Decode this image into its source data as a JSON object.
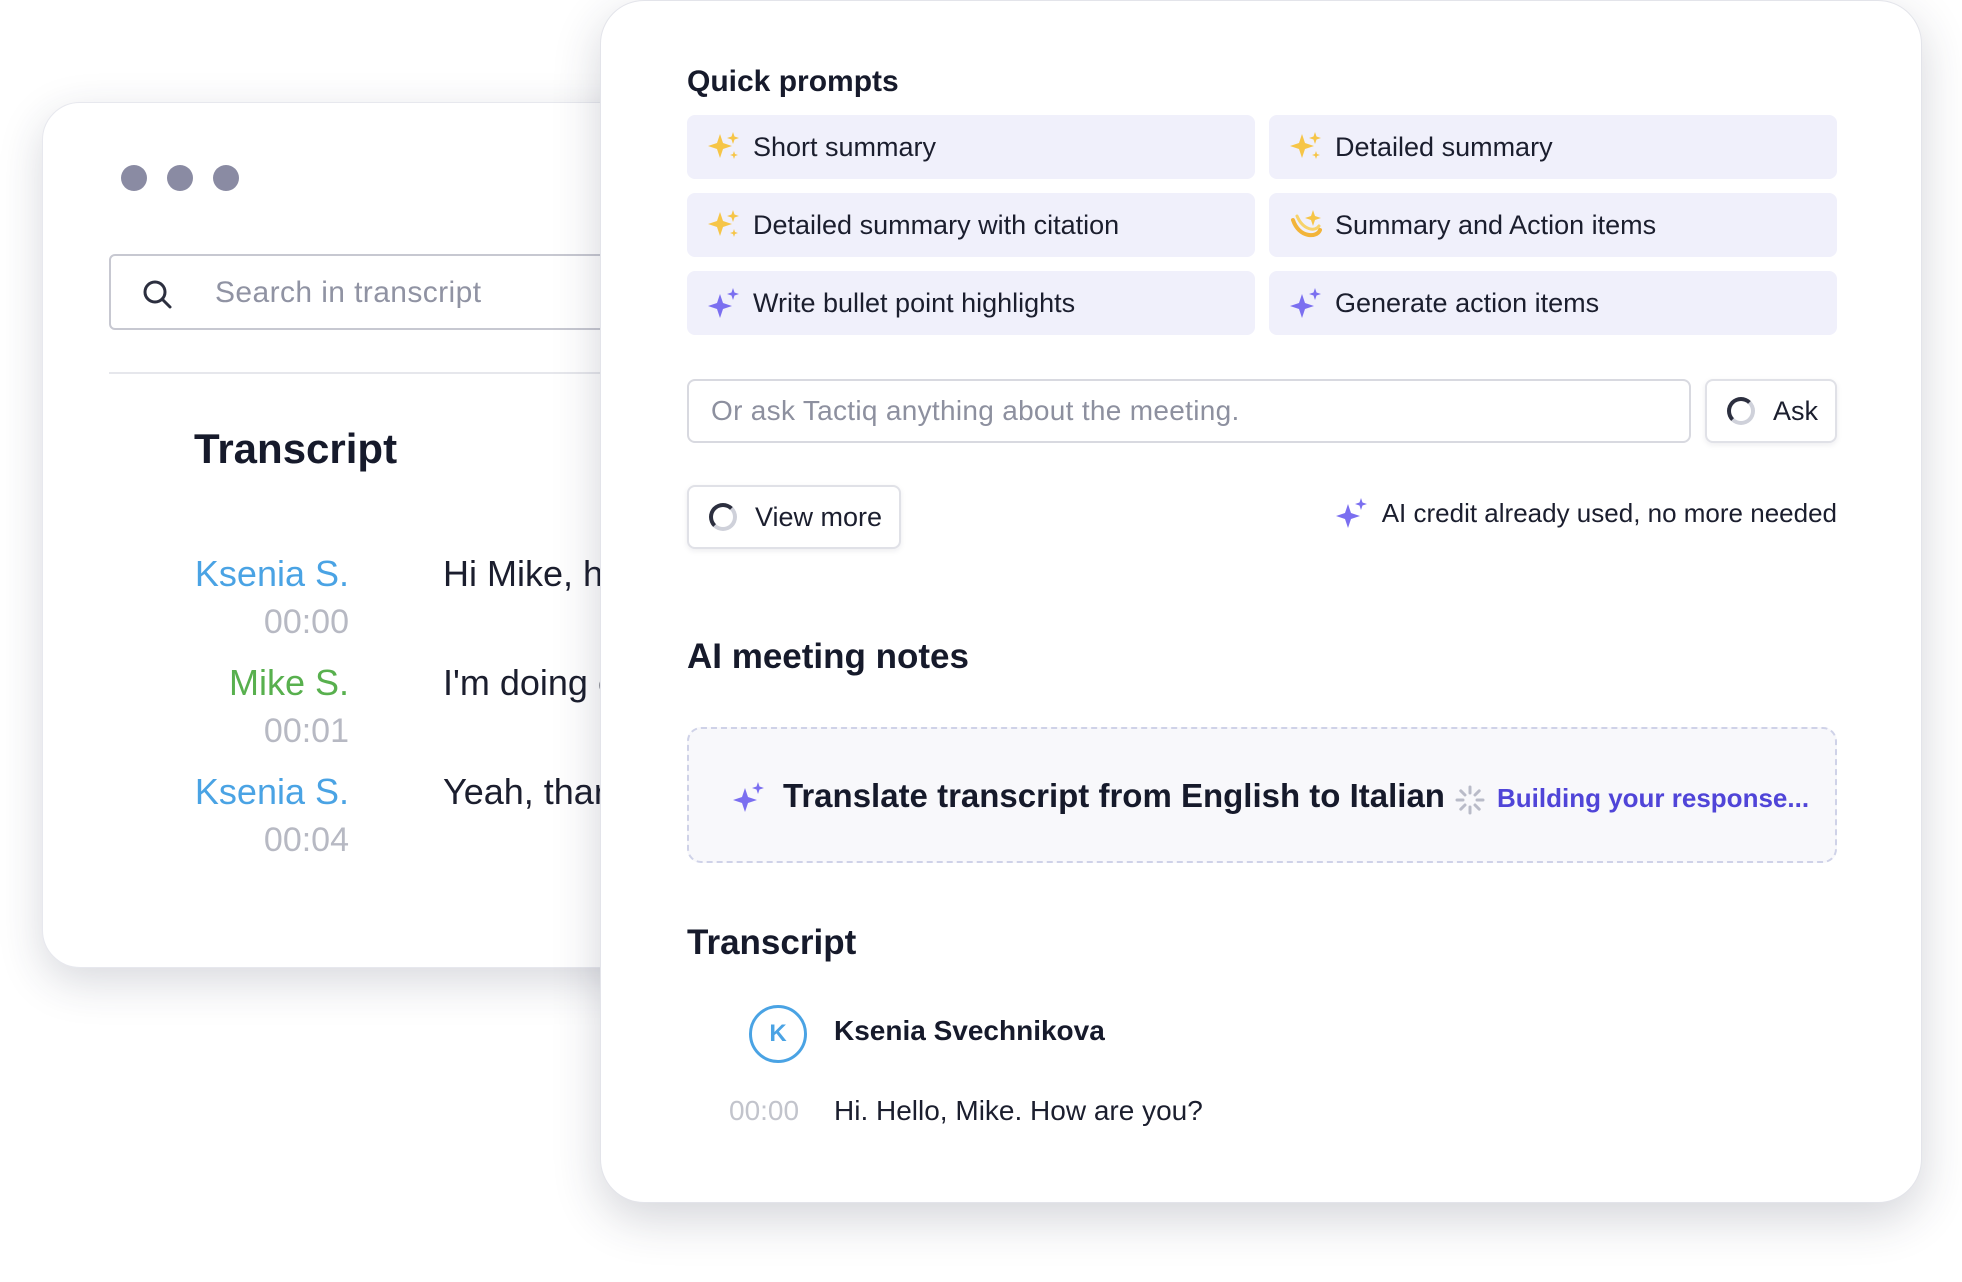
{
  "back_window": {
    "search_placeholder": "Search in transcript",
    "title": "Transcript",
    "entries": [
      {
        "speaker": "Ksenia S.",
        "time": "00:00",
        "text": "Hi Mike, h"
      },
      {
        "speaker": "Mike S.",
        "time": "00:01",
        "text": "I'm doing c"
      },
      {
        "speaker": "Ksenia S.",
        "time": "00:04",
        "text": "Yeah, thar"
      }
    ]
  },
  "front_window": {
    "quick_prompts_title": "Quick prompts",
    "prompts": [
      {
        "label": "Short summary",
        "icon": "sparkles-emoji-icon"
      },
      {
        "label": "Detailed summary",
        "icon": "sparkles-emoji-icon"
      },
      {
        "label": "Detailed summary with citation",
        "icon": "sparkles-emoji-icon"
      },
      {
        "label": "Summary and Action items",
        "icon": "dizzy-emoji-icon"
      },
      {
        "label": "Write bullet point highlights",
        "icon": "ai-sparkle-icon"
      },
      {
        "label": "Generate action items",
        "icon": "ai-sparkle-icon"
      }
    ],
    "ask_placeholder": "Or ask Tactiq anything about the meeting.",
    "ask_button": "Ask",
    "view_more_button": "View more",
    "credit_note": "AI credit already used, no more needed",
    "notes_title": "AI meeting notes",
    "notes_prompt": "Translate transcript from English to Italian",
    "notes_status": "Building your response...",
    "transcript_title": "Transcript",
    "speaker": {
      "initial": "K",
      "name": "Ksenia Svechnikova"
    },
    "line": {
      "time": "00:00",
      "text": "Hi. Hello, Mike. How are you?"
    }
  },
  "colors": {
    "accent_purple": "#5045d8",
    "sparkle_purple": "#7b6ff0",
    "chip_bg": "#f0f0fb",
    "speaker_blue": "#4aa3e4",
    "speaker_green": "#58b04e"
  }
}
